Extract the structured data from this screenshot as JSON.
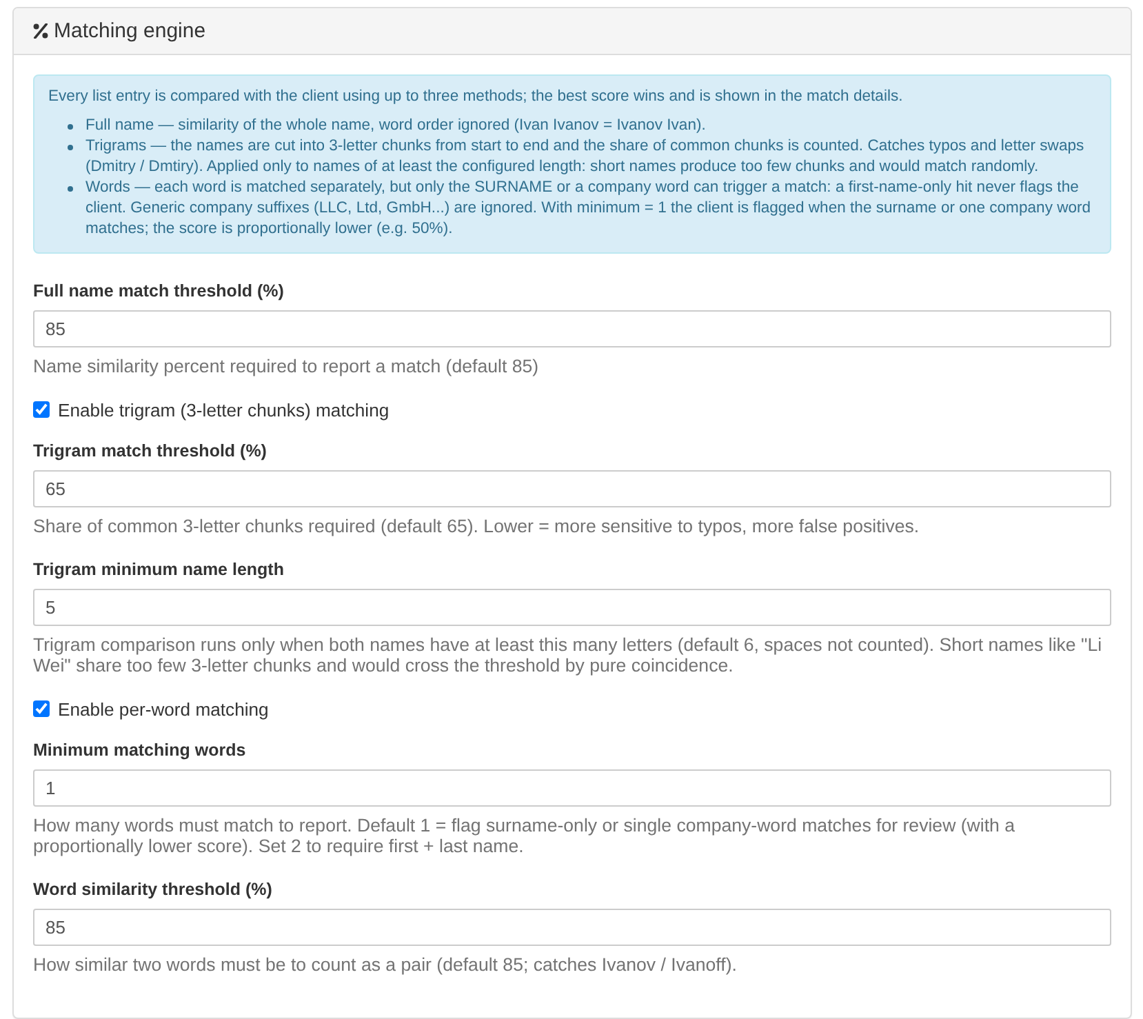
{
  "panel": {
    "title": "Matching engine",
    "info": {
      "intro": "Every list entry is compared with the client using up to three methods; the best score wins and is shown in the match details.",
      "items": [
        "Full name — similarity of the whole name, word order ignored (Ivan Ivanov = Ivanov Ivan).",
        "Trigrams — the names are cut into 3-letter chunks from start to end and the share of common chunks is counted. Catches typos and letter swaps (Dmitry / Dmtiry). Applied only to names of at least the configured length: short names produce too few chunks and would match randomly.",
        "Words — each word is matched separately, but only the SURNAME or a company word can trigger a match: a first-name-only hit never flags the client. Generic company suffixes (LLC, Ltd, GmbH...) are ignored. With minimum = 1 the client is flagged when the surname or one company word matches; the score is proportionally lower (e.g. 50%)."
      ]
    },
    "fields": [
      {
        "kind": "number",
        "label": "Full name match threshold (%)",
        "value": "85",
        "help": "Name similarity percent required to report a match (default 85)"
      },
      {
        "kind": "checkbox",
        "label": "Enable trigram (3-letter chunks) matching",
        "checked": true
      },
      {
        "kind": "number",
        "label": "Trigram match threshold (%)",
        "value": "65",
        "help": "Share of common 3-letter chunks required (default 65). Lower = more sensitive to typos, more false positives."
      },
      {
        "kind": "number",
        "label": "Trigram minimum name length",
        "value": "5",
        "help": "Trigram comparison runs only when both names have at least this many letters (default 6, spaces not counted). Short names like \"Li Wei\" share too few 3-letter chunks and would cross the threshold by pure coincidence."
      },
      {
        "kind": "checkbox",
        "label": "Enable per-word matching",
        "checked": true
      },
      {
        "kind": "number",
        "label": "Minimum matching words",
        "value": "1",
        "help": "How many words must match to report. Default 1 = flag surname-only or single company-word matches for review (with a proportionally lower score). Set 2 to require first + last name."
      },
      {
        "kind": "number",
        "label": "Word similarity threshold (%)",
        "value": "85",
        "help": "How similar two words must be to count as a pair (default 85; catches Ivanov / Ivanoff)."
      }
    ]
  }
}
